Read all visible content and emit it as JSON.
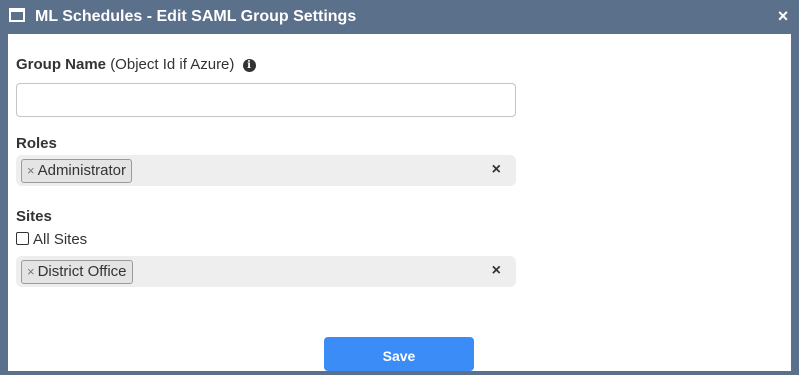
{
  "window": {
    "title": "ML Schedules - Edit SAML Group Settings",
    "close_glyph": "×",
    "icon": "window-icon"
  },
  "form": {
    "group_name": {
      "label": "Group Name",
      "hint": "(Object Id if Azure)",
      "info_glyph": "i",
      "value": "",
      "placeholder": ""
    },
    "roles": {
      "label": "Roles",
      "selected": [
        "Administrator"
      ],
      "clear_glyph": "×"
    },
    "sites": {
      "label": "Sites",
      "all_sites_label": "All Sites",
      "all_sites_checked": false,
      "selected": [
        "District Office"
      ],
      "clear_glyph": "×"
    },
    "chip_remove_glyph": "×",
    "save_label": "Save"
  },
  "colors": {
    "titlebar": "#5b708a",
    "accent": "#3b8cf7",
    "select_bg": "#eeeeee"
  }
}
